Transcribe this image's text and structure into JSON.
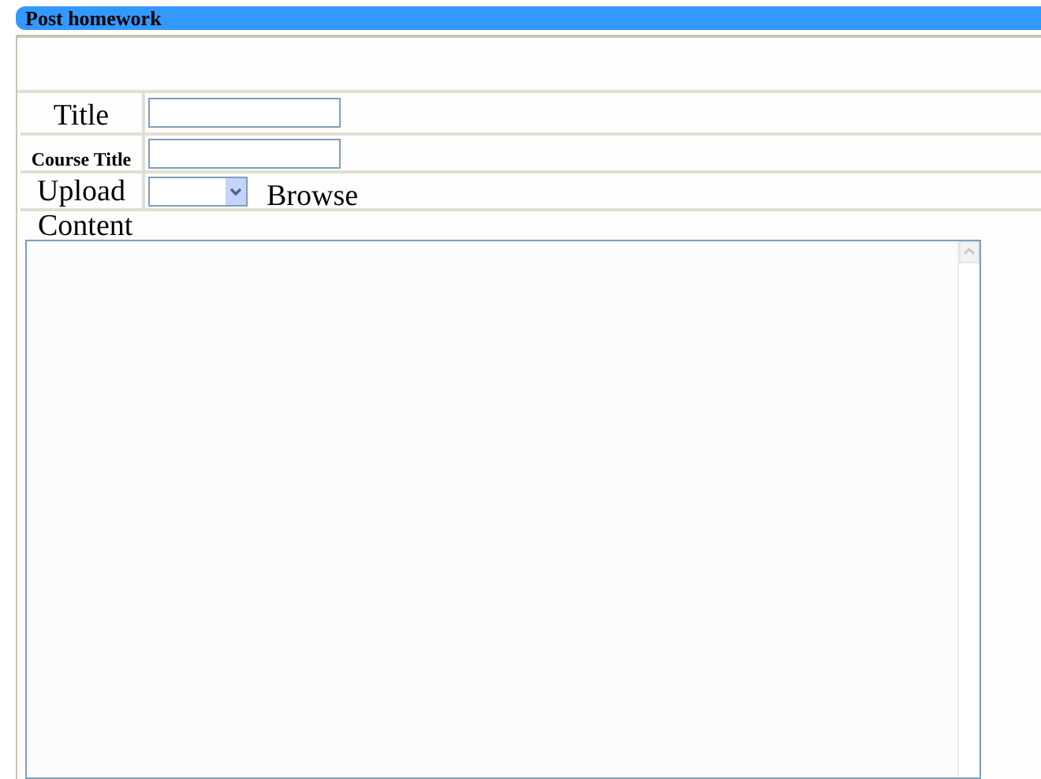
{
  "header": {
    "title": "Post homework"
  },
  "fields": [
    {
      "label": "Title",
      "kind": "text"
    },
    {
      "label": "Course Title",
      "kind": "text"
    },
    {
      "label": "Upload",
      "kind": "file",
      "button": "Browse"
    },
    {
      "label": "Content",
      "kind": "textarea"
    }
  ]
}
